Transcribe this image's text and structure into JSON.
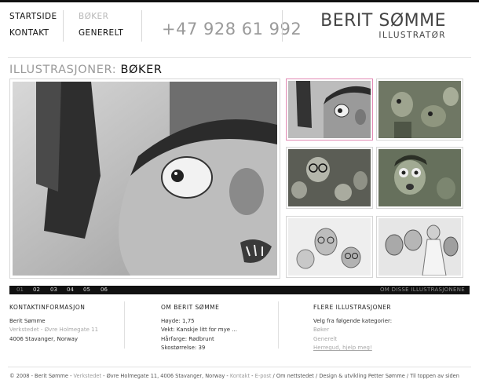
{
  "nav": {
    "startside": "STARTSIDE",
    "kontakt": "KONTAKT",
    "boker": "BØKER",
    "generelt": "GENERELT"
  },
  "phone": "+47 928 61 992",
  "brand": {
    "name": "BERIT SØMME",
    "subtitle": "ILLUSTRATØR"
  },
  "page_title": {
    "prefix": "ILLUSTRASJONER:",
    "main": "BØKER"
  },
  "main_image": {
    "icon": "illustration-boy-scared-face"
  },
  "thumbnails": [
    {
      "icon": "thumb-scared-boy",
      "active": true
    },
    {
      "icon": "thumb-cartoon-men-green"
    },
    {
      "icon": "thumb-crowd-faces-glasses"
    },
    {
      "icon": "thumb-surprised-boy-green"
    },
    {
      "icon": "thumb-faces-sketch"
    },
    {
      "icon": "thumb-people-sketch-woman"
    }
  ],
  "pager": {
    "pages": [
      "01",
      "02",
      "03",
      "04",
      "05",
      "06"
    ],
    "about": "OM DISSE ILLUSTRASJONENE"
  },
  "contact": {
    "title": "KONTAKTINFORMASJON",
    "name": "Berit Sømme",
    "address_link": "Verkstedet - Øvre Holmegate 11",
    "city": "4006 Stavanger, Norway"
  },
  "about": {
    "title": "OM BERIT SØMME",
    "lines": [
      "Høyde: 1,75",
      "Vekt: Kanskje litt for mye ...",
      "Hårfarge: Rødbrunt",
      "Skostørrelse: 39"
    ]
  },
  "more": {
    "title": "FLERE ILLUSTRASJONER",
    "intro": "Velg fra følgende kategorier:",
    "links": [
      "Bøker",
      "Generelt",
      "Herregud, hjelp meg!"
    ]
  },
  "copyright": {
    "lead": "© 2008 - Berit Sømme - ",
    "verkstedet": "Verkstedet",
    "addr": " - Øvre Holmegate 11, 4006 Stavanger, Norway - ",
    "kontakt": "Kontakt",
    "sep1": " - ",
    "epost": "E-post",
    "sep2": " / ",
    "om": "Om nettstedet",
    "sep3": " / ",
    "design": "Design & utvikling Petter Sømme",
    "sep4": " / ",
    "top": "Til toppen av siden"
  },
  "colors": {
    "accent_border": "#e28ab4",
    "pager_bg": "#111111",
    "muted": "#9a9a9a"
  }
}
